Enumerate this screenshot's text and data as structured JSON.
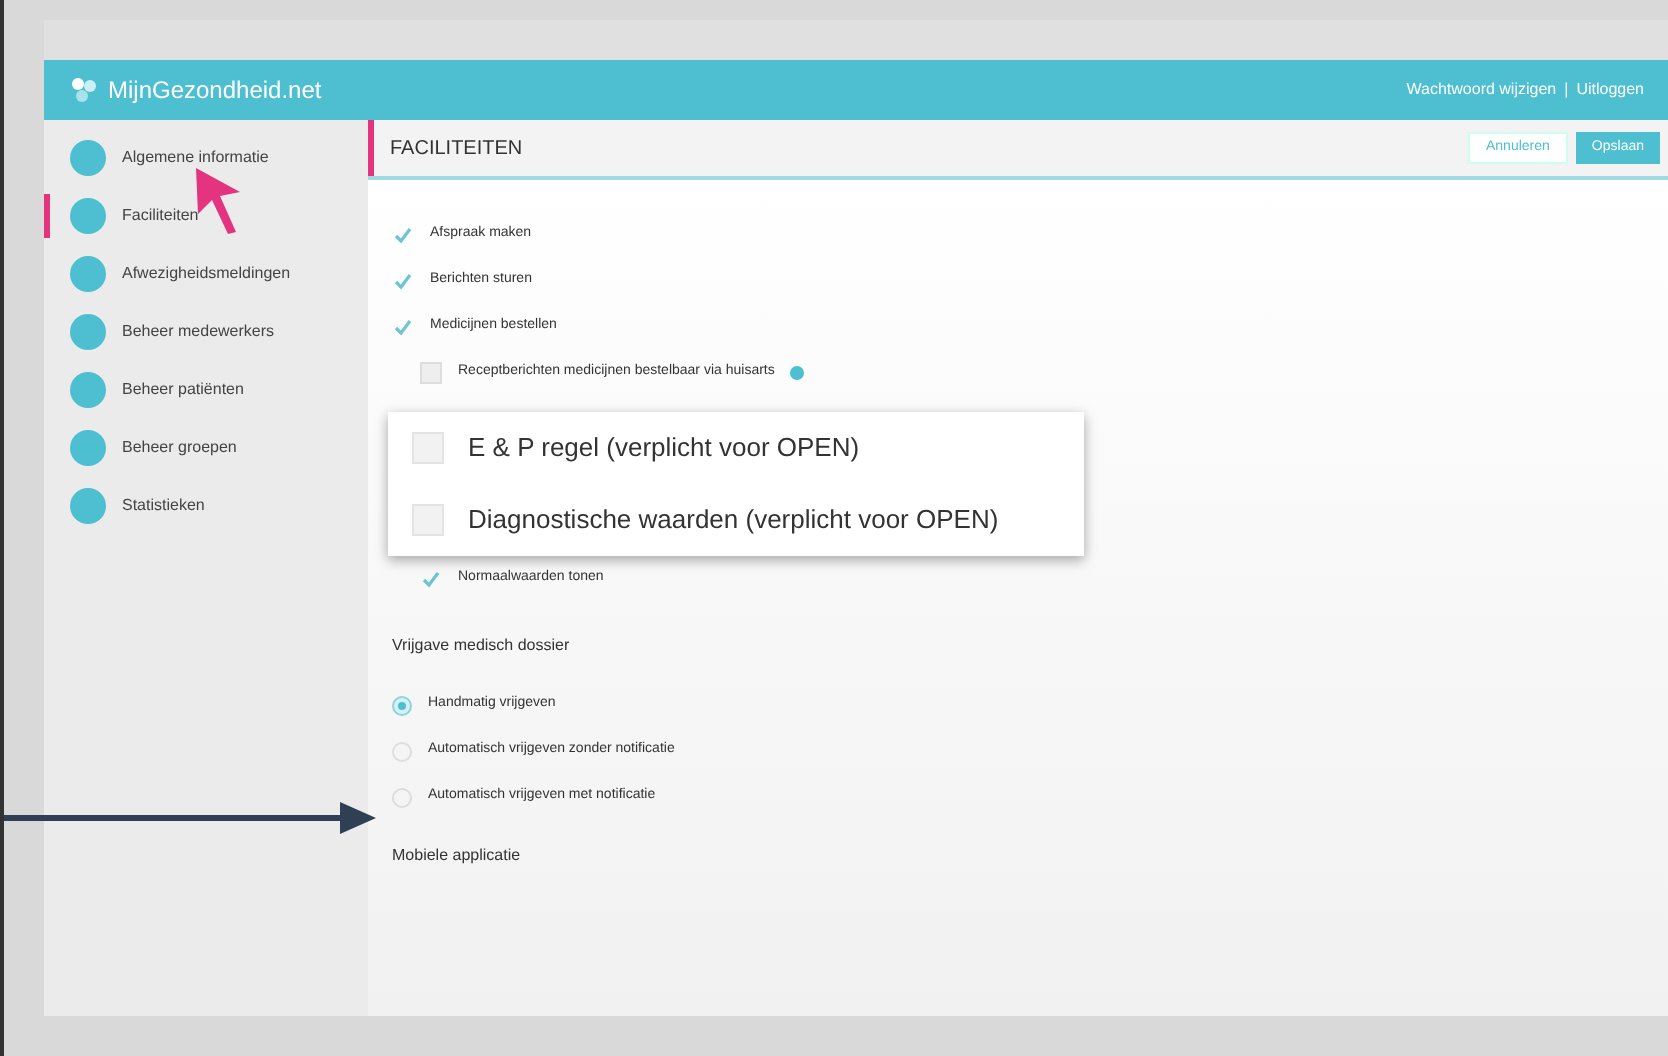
{
  "header": {
    "logo": "MijnGezondheid.net",
    "links": [
      "Wachtwoord wijzigen",
      "Uitloggen"
    ],
    "separator": "|"
  },
  "sidebar": {
    "items": [
      {
        "label": "Algemene informatie",
        "selected": false
      },
      {
        "label": "Faciliteiten",
        "selected": true
      },
      {
        "label": "Afwezigheidsmeldingen",
        "selected": false
      },
      {
        "label": "Beheer medewerkers",
        "selected": false
      },
      {
        "label": "Beheer patiënten",
        "selected": false
      },
      {
        "label": "Beheer groepen",
        "selected": false
      },
      {
        "label": "Statistieken",
        "selected": false
      }
    ]
  },
  "page": {
    "title": "FACILITEITEN",
    "buttons": [
      {
        "label": "Annuleren",
        "kind": "secondary"
      },
      {
        "label": "Opslaan",
        "kind": "primary"
      }
    ]
  },
  "facilities": [
    {
      "label": "Afspraak maken",
      "checked": true,
      "indented": false,
      "info": false
    },
    {
      "label": "Berichten sturen",
      "checked": true,
      "indented": false,
      "info": false
    },
    {
      "label": "Medicijnen bestellen",
      "checked": true,
      "indented": false,
      "info": false
    },
    {
      "label": "Receptberichten medicijnen bestelbaar via huisarts",
      "checked": false,
      "indented": true,
      "info": true
    },
    {
      "kind": "gap"
    },
    {
      "label": "Normaalwaarden tonen",
      "checked": true,
      "indented": true,
      "info": false
    }
  ],
  "popup": {
    "items": [
      {
        "label": "E & P regel (verplicht voor OPEN)",
        "checked": false
      },
      {
        "label": "Diagnostische waarden (verplicht voor OPEN)",
        "checked": false
      }
    ]
  },
  "release": {
    "title": "Vrijgave medisch dossier",
    "options": [
      {
        "label": "Handmatig vrijgeven",
        "selected": true
      },
      {
        "label": "Automatisch vrijgeven zonder notificatie",
        "selected": false
      },
      {
        "label": "Automatisch vrijgeven met notificatie",
        "selected": false
      }
    ]
  },
  "next_section": "Mobiele applicatie"
}
